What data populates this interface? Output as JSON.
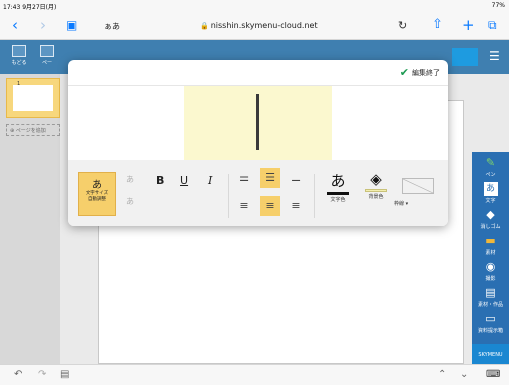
{
  "status": {
    "time": "17:43  9月27日(月)",
    "battery": "77%"
  },
  "browser": {
    "reader_label": "ぁあ",
    "url": "nisshin.skymenu-cloud.net"
  },
  "app_toolbar": {
    "buttons": [
      {
        "label": "もどる"
      },
      {
        "label": "ペー"
      }
    ]
  },
  "pages": {
    "current_page": "1",
    "add_page_label": "ページを追加"
  },
  "popup": {
    "done_label": "編集終了",
    "auto_size": {
      "glyph": "あ",
      "label_line1": "文字サイズ",
      "label_line2": "自動調整"
    },
    "small_a_up": "あ",
    "small_a_down": "あ",
    "bold": "B",
    "underline": "U",
    "italic": "I",
    "text_color": {
      "glyph": "あ",
      "label": "文字色",
      "color": "#111111"
    },
    "bg_color": {
      "label": "背景色",
      "color": "#fbf8cf"
    },
    "frame_label": "枠線 ▾"
  },
  "right_tools": [
    {
      "label": "ペン",
      "icon": "pen-icon"
    },
    {
      "label": "文字",
      "icon": "text-icon"
    },
    {
      "label": "消しゴム",
      "icon": "eraser-icon"
    },
    {
      "label": "素材",
      "icon": "material-icon"
    },
    {
      "label": "撮影",
      "icon": "camera-icon"
    },
    {
      "label": "素材・作品",
      "icon": "folder-icon"
    },
    {
      "label": "資料提示箱",
      "icon": "box-icon"
    }
  ],
  "brand": "SKYMENU"
}
